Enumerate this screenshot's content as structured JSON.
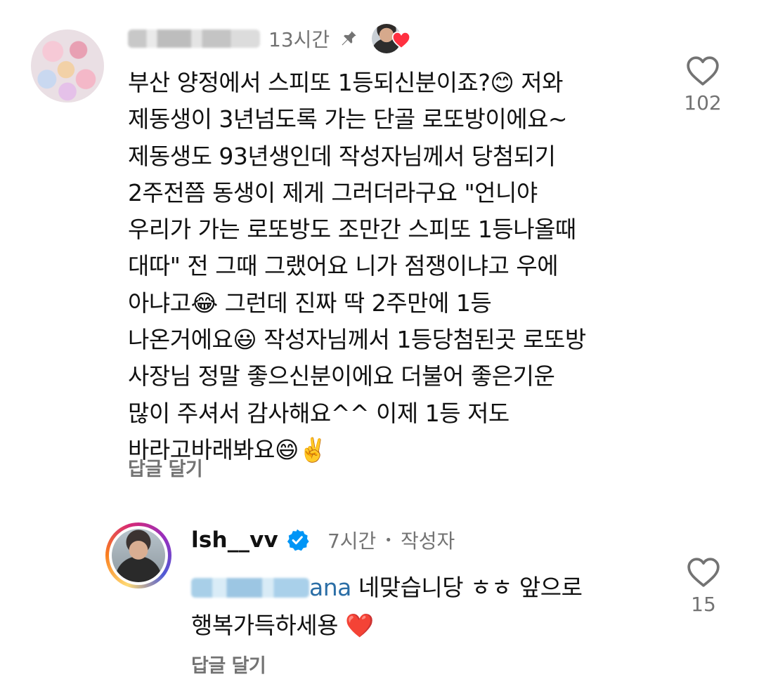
{
  "comment": {
    "time": "13시간",
    "text": "부산 양정에서 스피또 1등되신분이죠?😊 저와\n제동생이 3년넘도록 가는 단골 로또방이에요~\n제동생도 93년생인데 작성자님께서 당첨되기\n2주전쯤 동생이 제게 그러더라구요 \"언니야\n우리가 가는 로또방도 조만간 스피또 1등나올때\n대따\" 전 그때 그랬어요 니가 점쟁이냐고 우에\n아냐고😂 그런데 진짜 딱 2주만에 1등\n나온거에요😃 작성자님께서 1등당첨된곳 로또방\n사장님 정말 좋으신분이에요 더불어 좋은기운\n많이 주셔서 감사해요^^ 이제 1등 저도\n바라고바래봐요😄✌️",
    "like_count": "102",
    "reply_label": "답글 달기"
  },
  "reply": {
    "username": "lsh__vv",
    "time": "7시간",
    "separator": "•",
    "author_badge": "작성자",
    "mention_tail": "ana",
    "text": " 네맞습니당 ㅎㅎ 앞으로\n행복가득하세용 ❤️",
    "like_count": "15",
    "reply_label": "답글 달기"
  },
  "colors": {
    "secondary_text": "#737373",
    "verified_blue": "#0095f6",
    "creator_heart": "#ff3040"
  }
}
